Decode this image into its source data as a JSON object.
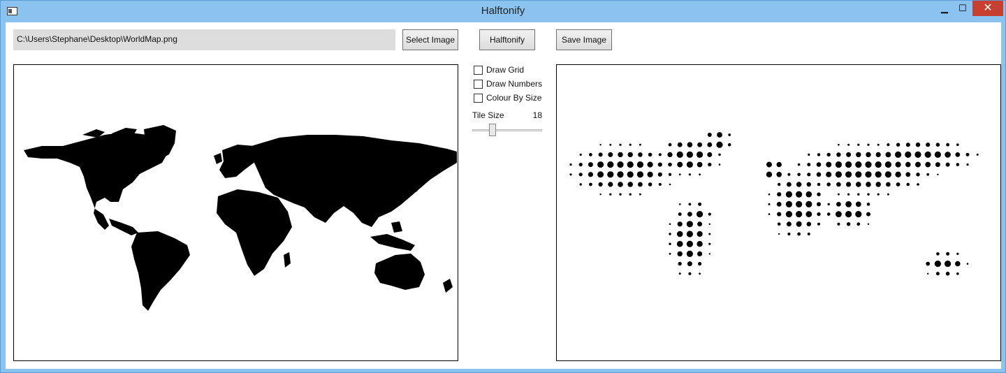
{
  "window": {
    "title": "Halftonify",
    "minimize_glyph": "▁",
    "maximize_glyph": "☐",
    "close_glyph": "✕"
  },
  "toolbar": {
    "path_value": "C:\\Users\\Stephane\\Desktop\\WorldMap.png",
    "select_label": "Select Image",
    "halftonify_label": "Halftonify",
    "save_label": "Save Image"
  },
  "options": {
    "draw_grid": {
      "label": "Draw Grid",
      "checked": false
    },
    "draw_numbers": {
      "label": "Draw Numbers",
      "checked": false
    },
    "colour_by_size": {
      "label": "Colour By Size",
      "checked": false
    },
    "tile_size_label": "Tile Size",
    "tile_size_value": "18"
  },
  "images": {
    "source": "world-map-silhouette",
    "result": "halftone-dot-world-map"
  }
}
